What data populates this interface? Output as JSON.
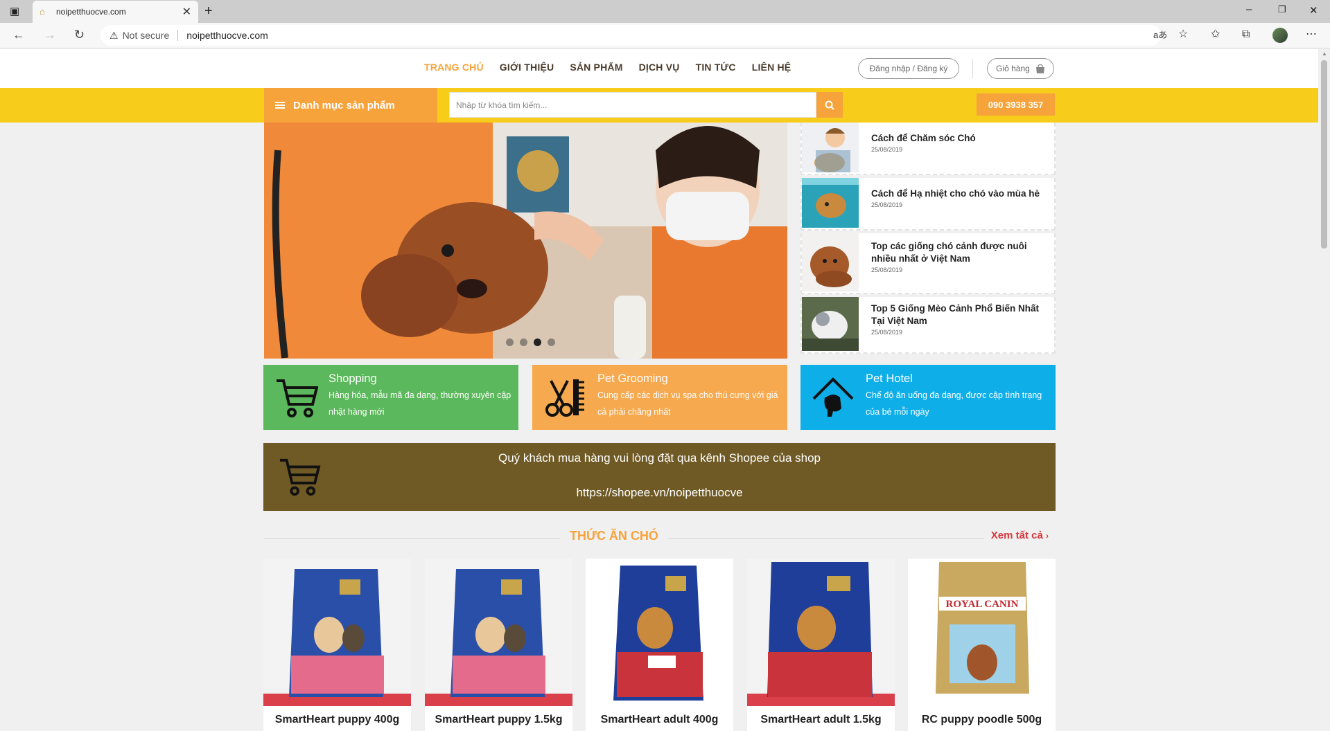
{
  "browser": {
    "tab_title": "noipetthuocve.com",
    "not_secure": "Not secure",
    "url": "noipetthuocve.com"
  },
  "nav": {
    "items": [
      "TRANG CHỦ",
      "GIỚI THIỆU",
      "SẢN PHẨM",
      "DỊCH VỤ",
      "TIN TỨC",
      "LIÊN HỆ"
    ],
    "login": "Đăng nhập / Đăng ký",
    "cart": "Giỏ hàng"
  },
  "toolbar": {
    "category": "Danh mục sản phẩm",
    "search_placeholder": "Nhập từ khóa tìm kiếm...",
    "phone": "090 3938 357"
  },
  "news": [
    {
      "title": "Cách để Chăm sóc Chó",
      "date": "25/08/2019"
    },
    {
      "title": "Cách để Hạ nhiệt cho chó vào mùa hè",
      "date": "25/08/2019"
    },
    {
      "title": "Top các giống chó cảnh được nuôi nhiều nhất ở Việt Nam",
      "date": "25/08/2019"
    },
    {
      "title": "Top 5 Giống Mèo Cảnh Phổ Biến Nhất Tại Việt Nam",
      "date": "25/08/2019"
    }
  ],
  "services": [
    {
      "title": "Shopping",
      "desc": "Hàng hóa, mẫu mã đa dạng, thường xuyên cập nhật hàng mới",
      "color": "#5cb85c"
    },
    {
      "title": "Pet Grooming",
      "desc": "Cung cấp các dịch vụ spa cho thú cưng với giá cả phải chăng nhất",
      "color": "#f6a94e"
    },
    {
      "title": "Pet Hotel",
      "desc": "Chế độ ăn uống đa dạng, được cập tình trạng của bé mỗi ngày",
      "color": "#0eaee9"
    }
  ],
  "shopee": {
    "line1": "Quý khách mua hàng vui lòng đặt qua kênh Shopee của shop",
    "line2": "https://shopee.vn/noipetthuocve"
  },
  "section": {
    "title": "THỨC ĂN CHÓ",
    "view_all": "Xem tất cả"
  },
  "products": [
    {
      "name": "SmartHeart puppy 400g"
    },
    {
      "name": "SmartHeart puppy 1.5kg"
    },
    {
      "name": "SmartHeart adult 400g"
    },
    {
      "name": "SmartHeart adult 1.5kg"
    },
    {
      "name": "RC puppy poodle 500g"
    }
  ]
}
